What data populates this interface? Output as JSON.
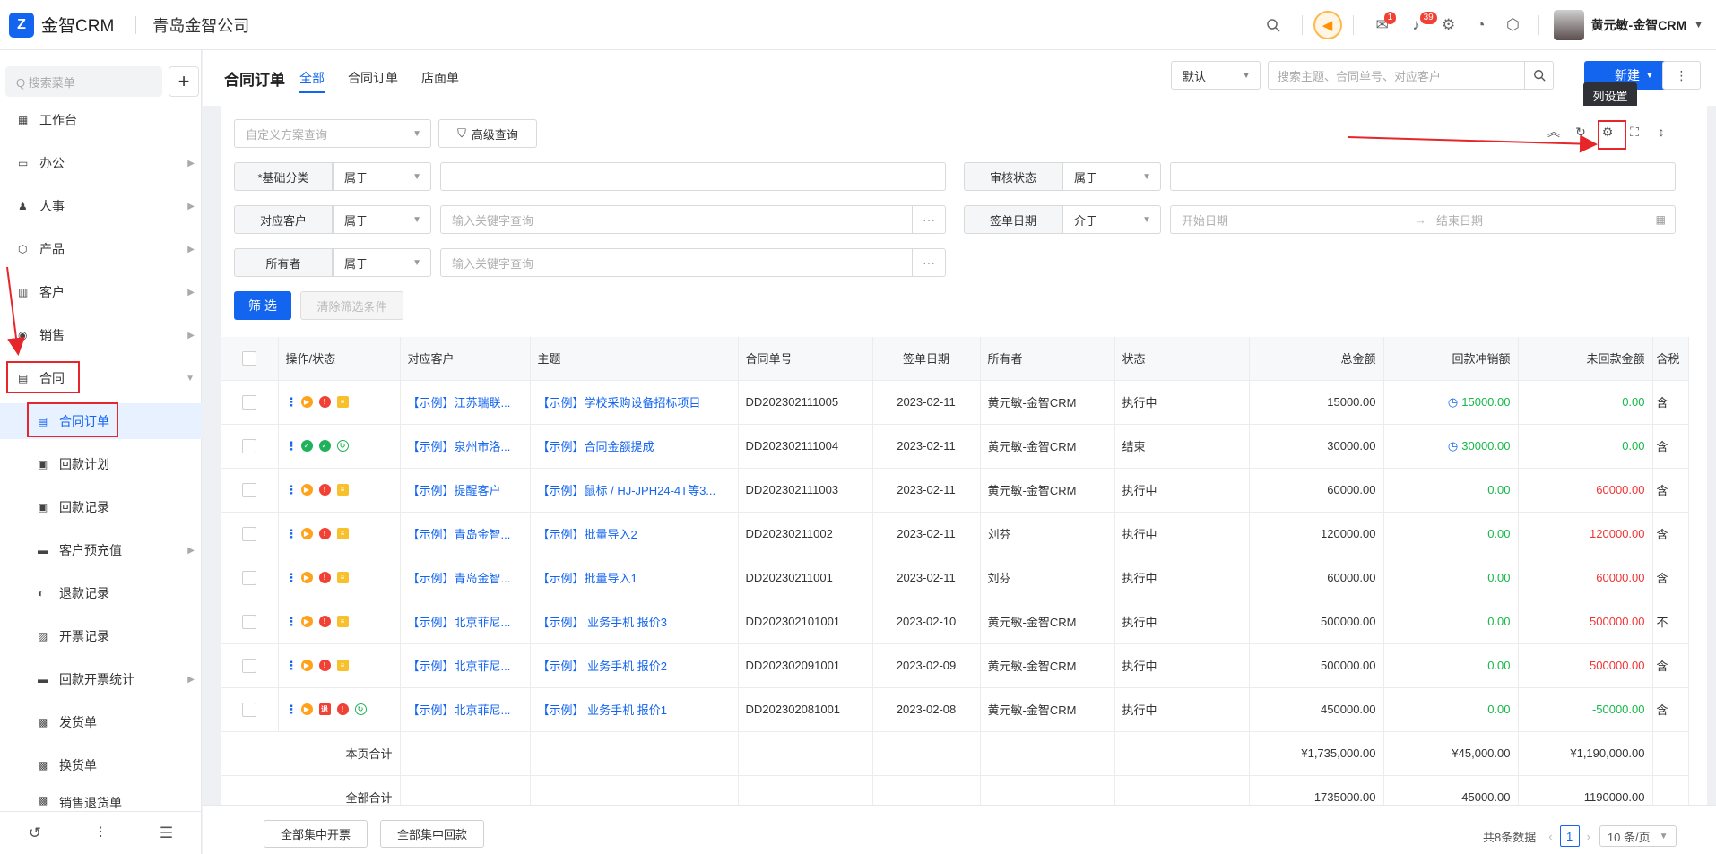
{
  "app": {
    "logo_text": "金智CRM",
    "company": "青岛金智公司"
  },
  "header": {
    "badge_messages": "1",
    "badge_notices": "39",
    "user_name": "黄元敏-金智CRM"
  },
  "sidebar": {
    "search_placeholder": "Q 搜索菜单",
    "items": [
      {
        "label": "工作台",
        "icon": "dashboard-icon"
      },
      {
        "label": "办公",
        "icon": "desktop-icon"
      },
      {
        "label": "人事",
        "icon": "people-icon"
      },
      {
        "label": "产品",
        "icon": "cube-icon"
      },
      {
        "label": "客户",
        "icon": "chart-icon"
      },
      {
        "label": "销售",
        "icon": "coin-icon"
      },
      {
        "label": "合同",
        "icon": "contract-icon"
      },
      {
        "label": "合同订单",
        "icon": "contract-icon"
      },
      {
        "label": "回款计划",
        "icon": "wallet-icon"
      },
      {
        "label": "回款记录",
        "icon": "wallet-icon"
      },
      {
        "label": "客户预充值",
        "icon": "folder-icon"
      },
      {
        "label": "退款记录",
        "icon": "refund-icon"
      },
      {
        "label": "开票记录",
        "icon": "printer-icon"
      },
      {
        "label": "回款开票统计",
        "icon": "folder-icon"
      },
      {
        "label": "发货单",
        "icon": "box-icon"
      },
      {
        "label": "换货单",
        "icon": "box-icon"
      },
      {
        "label": "销售退货单",
        "icon": "box-icon"
      }
    ]
  },
  "tabs": {
    "page_title": "合同订单",
    "items": [
      "全部",
      "合同订单",
      "店面单"
    ]
  },
  "toolbar": {
    "default_select": "默认",
    "search_placeholder": "搜索主题、合同单号、对应客户",
    "new_label": "新建",
    "tooltip": "列设置"
  },
  "filters": {
    "custom_query_placeholder": "自定义方案查询",
    "advanced_query": "高级查询",
    "base_category": "*基础分类",
    "audit_status": "审核状态",
    "customer": "对应客户",
    "sign_date": "签单日期",
    "owner": "所有者",
    "op_belongs": "属于",
    "op_between": "介于",
    "keyword_placeholder": "输入关键字查询",
    "start_date": "开始日期",
    "end_date": "结束日期",
    "filter_btn": "筛 选",
    "clear_btn": "清除筛选条件"
  },
  "table": {
    "headers": [
      "操作/状态",
      "对应客户",
      "主题",
      "合同单号",
      "签单日期",
      "所有者",
      "状态",
      "总金额",
      "回款冲销额",
      "未回款金额",
      "含税"
    ],
    "rows": [
      {
        "customer": "【示例】江苏瑞联...",
        "subject": "【示例】学校采购设备招标项目",
        "no": "DD202302111005",
        "date": "2023-02-11",
        "owner": "黄元敏-金智CRM",
        "status": "执行中",
        "total": "15000.00",
        "paid": "15000.00",
        "unpaid": "0.00",
        "tax": "含"
      },
      {
        "customer": "【示例】泉州市洛...",
        "subject": "【示例】合同金额提成",
        "no": "DD202302111004",
        "date": "2023-02-11",
        "owner": "黄元敏-金智CRM",
        "status": "结束",
        "total": "30000.00",
        "paid": "30000.00",
        "unpaid": "0.00",
        "tax": "含"
      },
      {
        "customer": "【示例】提醒客户",
        "subject": "【示例】鼠标 / HJ-JPH24-4T等3...",
        "no": "DD202302111003",
        "date": "2023-02-11",
        "owner": "黄元敏-金智CRM",
        "status": "执行中",
        "total": "60000.00",
        "paid": "0.00",
        "unpaid": "60000.00",
        "tax": "含"
      },
      {
        "customer": "【示例】青岛金智...",
        "subject": "【示例】批量导入2",
        "no": "DD20230211002",
        "date": "2023-02-11",
        "owner": "刘芬",
        "status": "执行中",
        "total": "120000.00",
        "paid": "0.00",
        "unpaid": "120000.00",
        "tax": "含"
      },
      {
        "customer": "【示例】青岛金智...",
        "subject": "【示例】批量导入1",
        "no": "DD20230211001",
        "date": "2023-02-11",
        "owner": "刘芬",
        "status": "执行中",
        "total": "60000.00",
        "paid": "0.00",
        "unpaid": "60000.00",
        "tax": "含"
      },
      {
        "customer": "【示例】北京菲尼...",
        "subject": "【示例】 业务手机 报价3",
        "no": "DD202302101001",
        "date": "2023-02-10",
        "owner": "黄元敏-金智CRM",
        "status": "执行中",
        "total": "500000.00",
        "paid": "0.00",
        "unpaid": "500000.00",
        "tax": "不"
      },
      {
        "customer": "【示例】北京菲尼...",
        "subject": "【示例】 业务手机 报价2",
        "no": "DD202302091001",
        "date": "2023-02-09",
        "owner": "黄元敏-金智CRM",
        "status": "执行中",
        "total": "500000.00",
        "paid": "0.00",
        "unpaid": "500000.00",
        "tax": "含"
      },
      {
        "customer": "【示例】北京菲尼...",
        "subject": "【示例】 业务手机 报价1",
        "no": "DD202302081001",
        "date": "2023-02-08",
        "owner": "黄元敏-金智CRM",
        "status": "执行中",
        "total": "450000.00",
        "paid": "0.00",
        "unpaid": "-50000.00",
        "tax": "含"
      }
    ],
    "page_total": {
      "label": "本页合计",
      "total": "¥1,735,000.00",
      "paid": "¥45,000.00",
      "unpaid": "¥1,190,000.00"
    },
    "all_total": {
      "label": "全部合计",
      "total": "1735000.00",
      "paid": "45000.00",
      "unpaid": "1190000.00"
    }
  },
  "footer": {
    "btn_invoice": "全部集中开票",
    "btn_payment": "全部集中回款",
    "total_text": "共8条数据",
    "page": "1",
    "page_size": "10 条/页"
  }
}
